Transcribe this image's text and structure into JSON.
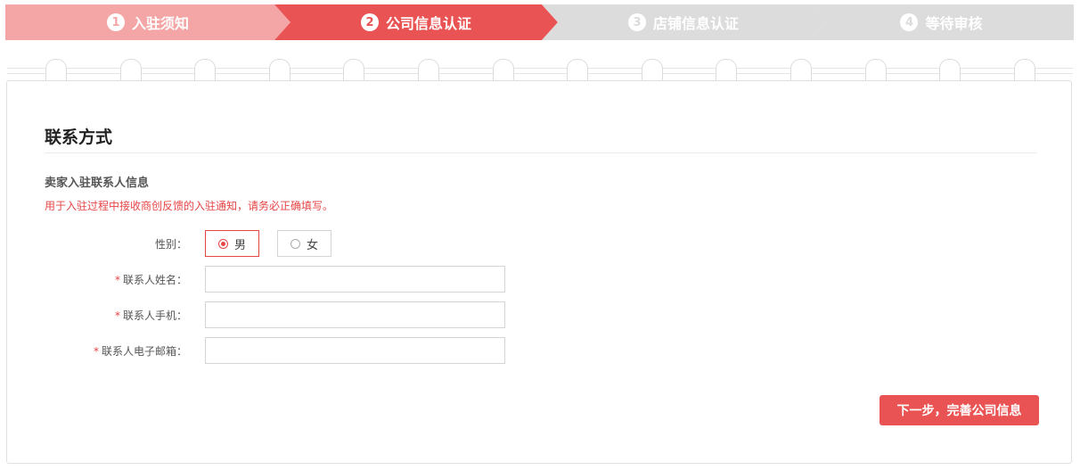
{
  "colors": {
    "accent": "#e95353",
    "step_done": "#f4a6a6",
    "step_active": "#e95353",
    "step_pending": "#dcdcdc"
  },
  "steps": [
    {
      "num": "1",
      "label": "入驻须知",
      "state": "done"
    },
    {
      "num": "2",
      "label": "公司信息认证",
      "state": "active"
    },
    {
      "num": "3",
      "label": "店铺信息认证",
      "state": "pending"
    },
    {
      "num": "4",
      "label": "等待审核",
      "state": "pending"
    }
  ],
  "section": {
    "title": "联系方式",
    "subtitle": "卖家入驻联系人信息",
    "notice": "用于入驻过程中接收商创反馈的入驻通知，请务必正确填写。"
  },
  "form": {
    "gender": {
      "label": "性别：",
      "options": [
        {
          "label": "男",
          "selected": true
        },
        {
          "label": "女",
          "selected": false
        }
      ]
    },
    "name": {
      "required_mark": "*",
      "label": "联系人姓名：",
      "value": ""
    },
    "phone": {
      "required_mark": "*",
      "label": "联系人手机：",
      "value": ""
    },
    "email": {
      "required_mark": "*",
      "label": "联系人电子邮箱：",
      "value": ""
    }
  },
  "next_button": {
    "label": "下一步，完善公司信息"
  }
}
